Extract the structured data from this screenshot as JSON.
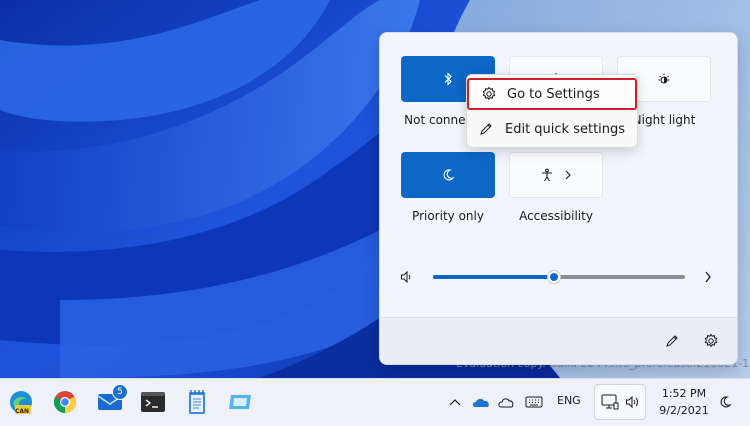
{
  "flyout": {
    "tiles": [
      {
        "label": "Not connected",
        "state": "on",
        "icon": "bluetooth-icon"
      },
      {
        "label": "",
        "state": "off",
        "icon": "airplane-icon"
      },
      {
        "label": "Night light",
        "state": "off",
        "icon": "night-light-icon"
      },
      {
        "label": "Priority only",
        "state": "on",
        "icon": "focus-moon-icon"
      },
      {
        "label": "Accessibility",
        "state": "off",
        "icon": "accessibility-icon"
      }
    ],
    "volume": {
      "level": 0.48,
      "icon": "speaker-icon"
    },
    "footer": {
      "edit_icon": "pencil-icon",
      "settings_icon": "gear-icon"
    }
  },
  "context_menu": {
    "items": [
      {
        "label": "Go to Settings",
        "icon": "gear-icon",
        "highlighted": true
      },
      {
        "label": "Edit quick settings",
        "icon": "pencil-icon"
      }
    ]
  },
  "watermark": "Evaluation copy. Build 22449.rs_prerelease.210821-1550",
  "taskbar": {
    "apps": [
      {
        "name": "Microsoft Edge Canary",
        "badge_text": "CAN"
      },
      {
        "name": "Google Chrome"
      },
      {
        "name": "Mail",
        "badge": "5"
      },
      {
        "name": "Windows Terminal"
      },
      {
        "name": "Notepad"
      },
      {
        "name": "Remote Desktop"
      }
    ],
    "tray": {
      "language": "ENG",
      "time": "1:52 PM",
      "date": "9/2/2021"
    }
  },
  "colors": {
    "accent": "#0c67c6",
    "highlight_border": "#d0202d"
  }
}
